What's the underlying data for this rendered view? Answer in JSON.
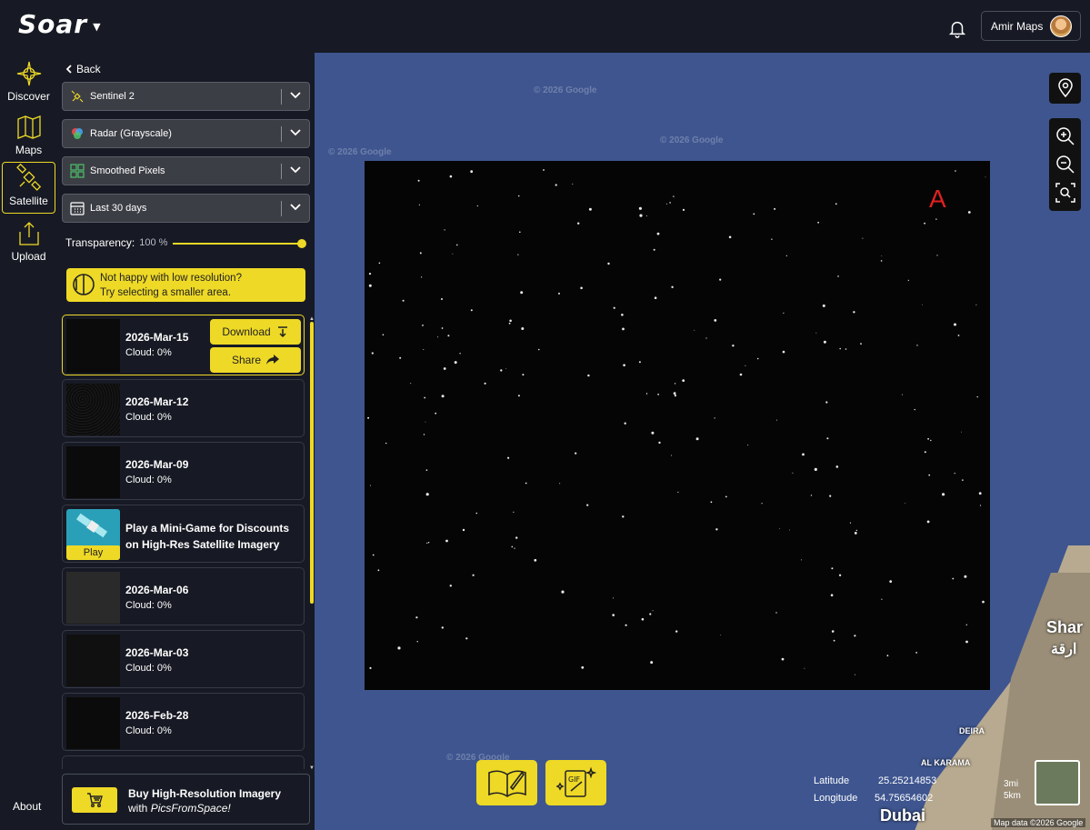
{
  "app": {
    "logo": "Soar"
  },
  "header": {
    "user_name": "Amir Maps"
  },
  "nav": {
    "items": [
      {
        "label": "Discover",
        "icon": "compass-star-icon"
      },
      {
        "label": "Maps",
        "icon": "map-icon"
      },
      {
        "label": "Satellite",
        "icon": "satellite-icon",
        "active": true
      },
      {
        "label": "Upload",
        "icon": "upload-icon"
      }
    ],
    "about": "About"
  },
  "panel": {
    "back": "Back",
    "satellite_select": "Sentinel 2",
    "layer_select": "Radar (Grayscale)",
    "render_select": "Smoothed Pixels",
    "date_select": "Last 30 days",
    "transparency_label": "Transparency:",
    "transparency_value": "100 %",
    "transparency_level": 1.0,
    "notice_line1": "Not happy with low resolution?",
    "notice_line2": "Try selecting a smaller area."
  },
  "results": [
    {
      "date": "2026-Mar-15",
      "cloud": "Cloud: 0%",
      "active": true
    },
    {
      "date": "2026-Mar-12",
      "cloud": "Cloud: 0%"
    },
    {
      "date": "2026-Mar-09",
      "cloud": "Cloud: 0%"
    },
    {
      "date": "2026-Mar-06",
      "cloud": "Cloud: 0%"
    },
    {
      "date": "2026-Mar-03",
      "cloud": "Cloud: 0%"
    },
    {
      "date": "2026-Feb-28",
      "cloud": "Cloud: 0%"
    }
  ],
  "actions": {
    "download": "Download",
    "share": "Share"
  },
  "promo": {
    "line1": "Play a Mini-Game for Discounts",
    "line2": "on High-Res Satellite Imagery",
    "play": "Play"
  },
  "buy": {
    "line1": "Buy High-Resolution Imagery",
    "line2_prefix": "with ",
    "line2_brand": "PicsFromSpace!"
  },
  "map": {
    "overlay_label": "A",
    "watermark": "© 2026 Google",
    "latitude_label": "Latitude",
    "latitude_value": "25.25214853",
    "longitude_label": "Longitude",
    "longitude_value": "54.75654602",
    "scale": "3mi",
    "scale_km": "5km",
    "city_dubai": "Dubai",
    "city_sharjah": "Shar",
    "city_sharjah_ar": "ارقة",
    "district_deira": "DEIRA",
    "district_karama": "AL KARAMA",
    "attribution": "Map data ©2026 Google"
  },
  "colors": {
    "accent": "#eed926",
    "background": "#171a24",
    "water": "#3e558f"
  }
}
